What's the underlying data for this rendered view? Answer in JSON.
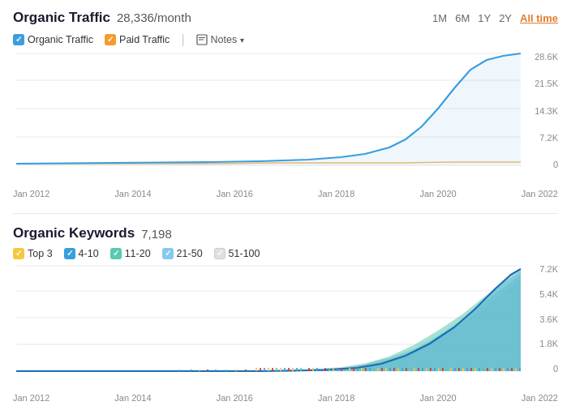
{
  "organicTraffic": {
    "title": "Organic Traffic",
    "value": "28,336/month",
    "timeFilters": [
      "1M",
      "6M",
      "1Y",
      "2Y",
      "All time"
    ],
    "activeFilter": "All time",
    "legend": [
      {
        "label": "Organic Traffic",
        "color": "blue",
        "checked": true
      },
      {
        "label": "Paid Traffic",
        "color": "orange",
        "checked": true
      }
    ],
    "notes": "Notes",
    "yAxis": [
      "28.6K",
      "21.5K",
      "14.3K",
      "7.2K",
      "0"
    ],
    "xAxis": [
      "Jan 2012",
      "Jan 2014",
      "Jan 2016",
      "Jan 2018",
      "Jan 2020",
      "Jan 2022"
    ]
  },
  "organicKeywords": {
    "title": "Organic Keywords",
    "value": "7,198",
    "legend": [
      {
        "label": "Top 3",
        "color": "yellow",
        "checked": true
      },
      {
        "label": "4-10",
        "color": "blue",
        "checked": true
      },
      {
        "label": "11-20",
        "color": "teal",
        "checked": true
      },
      {
        "label": "21-50",
        "color": "light-blue",
        "checked": true
      },
      {
        "label": "51-100",
        "color": "gray",
        "checked": true
      }
    ],
    "yAxis": [
      "7.2K",
      "5.4K",
      "3.6K",
      "1.8K",
      "0"
    ],
    "xAxis": [
      "Jan 2012",
      "Jan 2014",
      "Jan 2016",
      "Jan 2018",
      "Jan 2020",
      "Jan 2022"
    ]
  }
}
